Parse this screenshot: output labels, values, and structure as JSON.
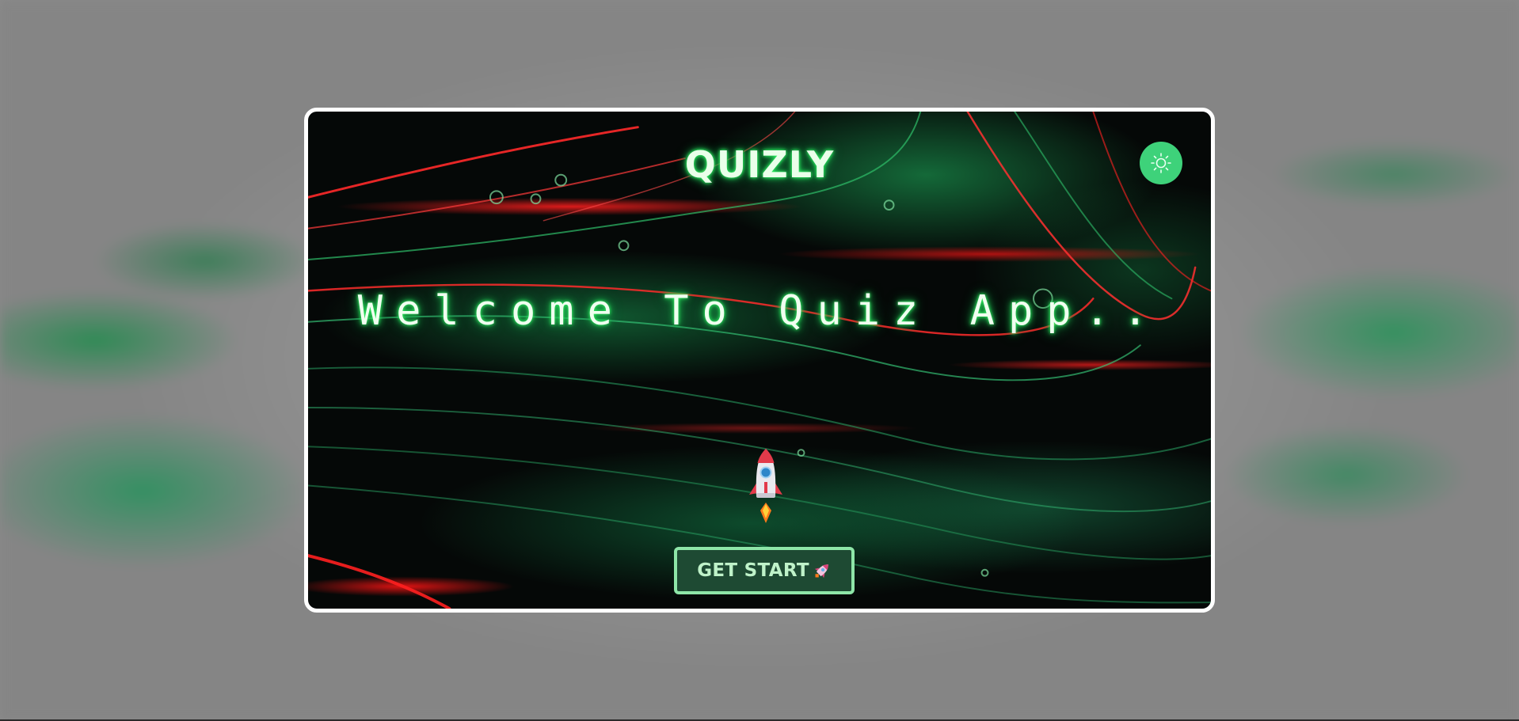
{
  "app": {
    "title": "QUIZLY"
  },
  "hero": {
    "welcome_text": "Welcome To Quiz App.."
  },
  "actions": {
    "get_start_label": "GET START"
  },
  "icons": {
    "theme_toggle": "sun-icon",
    "hero_image": "rocket-icon",
    "button_icon": "rocket-icon"
  },
  "colors": {
    "accent_green": "#3ed27a",
    "button_bg": "#1e4a33",
    "button_border": "#8ee6a8",
    "title_glow": "#33ff66",
    "card_border": "#ffffff"
  }
}
